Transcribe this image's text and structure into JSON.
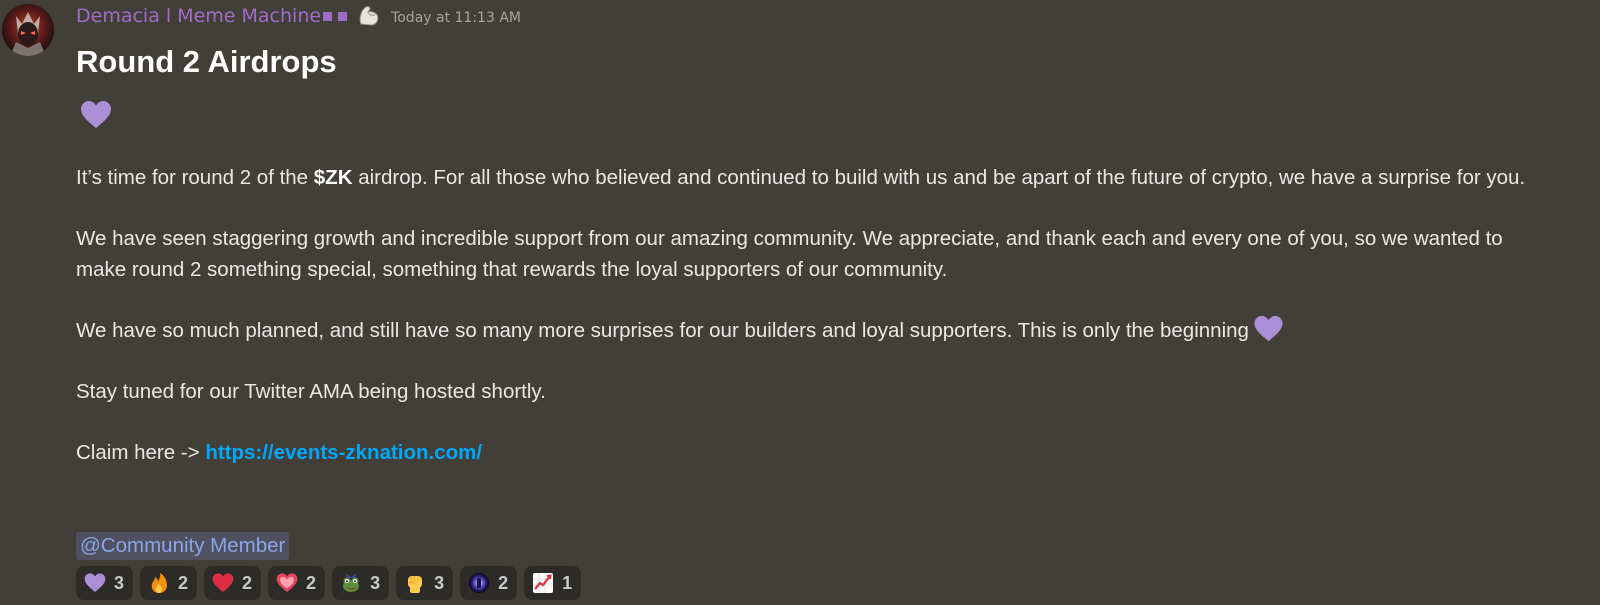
{
  "message": {
    "author": "Demacia l Meme Machine",
    "timestamp": "Today at 11:13 AM",
    "title": "Round 2 Airdrops",
    "paragraphs": {
      "p1_before": "It’s time for round 2 of the ",
      "p1_bold": "$ZK",
      "p1_after": " airdrop. For all those who believed and continued to build with us and be apart of the future of crypto, we have a surprise for you.",
      "p2": "We have seen staggering growth and incredible support from our amazing community. We appreciate, and thank each and every one of you, so we wanted to make round 2 something special, something that rewards the loyal supporters of our community.",
      "p3": "We have so much planned, and still have so many more surprises for our builders and loyal supporters. This is only the beginning",
      "p4": "Stay tuned for our Twitter AMA being hosted shortly.",
      "p5_prefix": "Claim here -> ",
      "p5_link": "https://events-zknation.com/"
    },
    "mention": "@Community Member",
    "role_color": "#a06bc9"
  },
  "reactions": [
    {
      "icon": "purple-heart-icon",
      "count": "3"
    },
    {
      "icon": "fire-icon",
      "count": "2"
    },
    {
      "icon": "red-heart-icon",
      "count": "2"
    },
    {
      "icon": "heart-icon",
      "count": "2"
    },
    {
      "icon": "pepe-icon",
      "count": "3"
    },
    {
      "icon": "raised-fist-icon",
      "count": "3"
    },
    {
      "icon": "portal-icon",
      "count": "2"
    },
    {
      "icon": "chart-increasing-icon",
      "count": "1"
    }
  ]
}
